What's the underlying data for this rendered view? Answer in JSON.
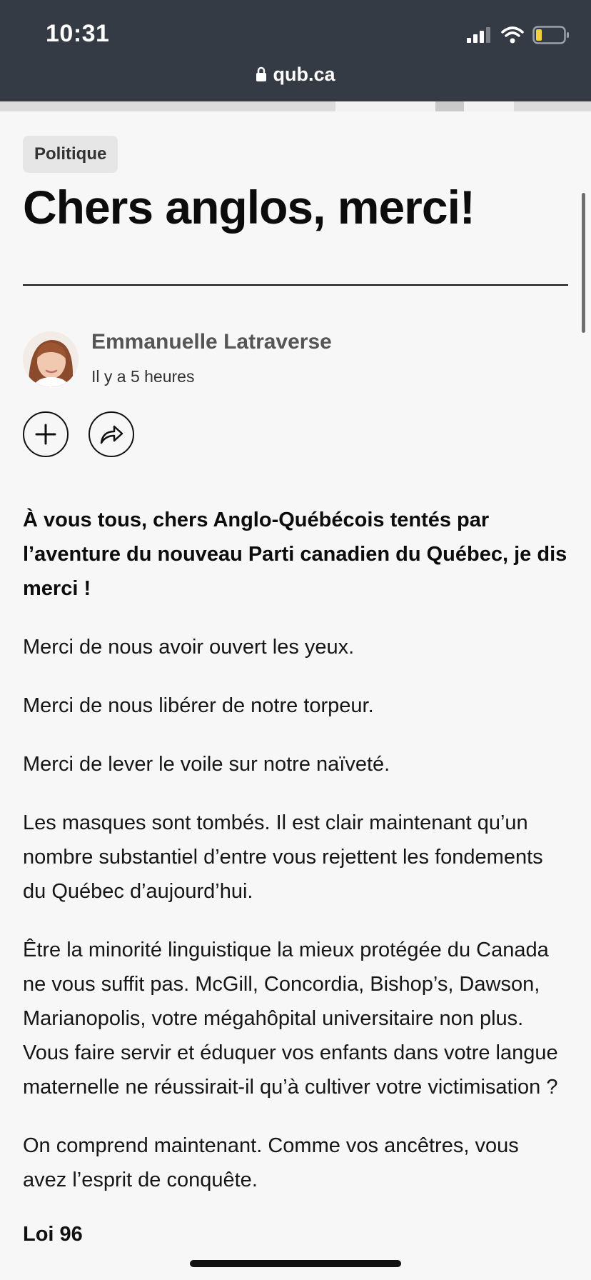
{
  "status_bar": {
    "time": "10:31",
    "url": "qub.ca"
  },
  "article": {
    "category": "Politique",
    "headline": "Chers anglos, merci!",
    "author": "Emmanuelle Latraverse",
    "timestamp": "Il y a 5 heures",
    "paragraphs": [
      "À vous tous, chers Anglo-Québécois tentés par l’aventure du nouveau Parti canadien du Québec, je dis merci !",
      "Merci de nous avoir ouvert les yeux.",
      "Merci de nous libérer de notre torpeur.",
      "Merci de lever le voile sur notre naïveté.",
      "Les masques sont tombés. Il est clair maintenant qu’un nombre substantiel d’entre vous rejettent les fondements du Québec d’aujourd’hui.",
      "Être la minorité linguistique la mieux protégée du Canada ne vous suffit pas. McGill, Concordia, Bishop’s, Dawson, Marianopolis, votre mégahôpital universitaire non plus. Vous faire servir et éduquer vos enfants dans votre langue maternelle ne réussirait-il qu’à cultiver votre victimisation ?",
      "On comprend maintenant. Comme vos ancêtres, vous avez l’esprit de conquête."
    ],
    "subheading": "Loi 96"
  },
  "icons": {
    "lock": "lock-icon",
    "signal": "signal-icon",
    "wifi": "wifi-icon",
    "battery": "battery-icon",
    "follow": "plus-icon",
    "share": "share-icon"
  },
  "colors": {
    "status_bar_bg": "#353b45",
    "page_bg": "#f7f7f7",
    "badge_bg": "#e6e6e6",
    "battery_fill": "#f4d03f"
  }
}
